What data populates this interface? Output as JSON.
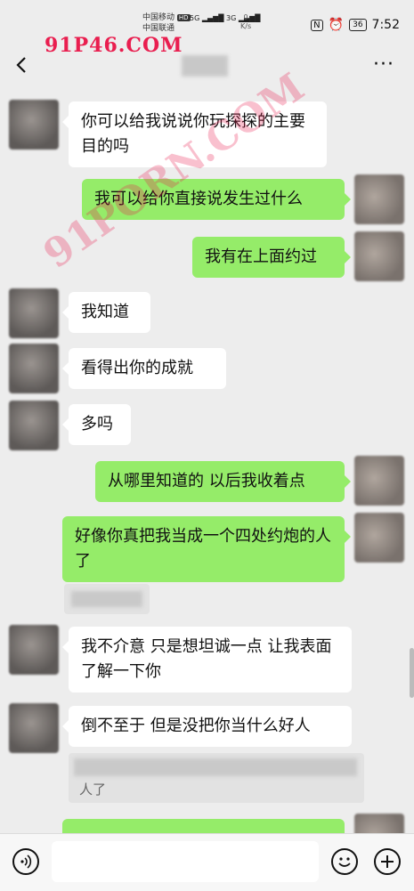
{
  "status_bar": {
    "carrier_1": "中国移动",
    "carrier_2": "中国联通",
    "hd": "HD",
    "net_1": "5G",
    "net_2": "3G",
    "speed_value": "0",
    "speed_unit": "K/s",
    "nfc": "N",
    "battery": "36",
    "time": "7:52"
  },
  "watermark": {
    "top_text": "91P46.COM",
    "diagonal_text": "91PORN.COM"
  },
  "navbar": {
    "more_label": "···"
  },
  "messages": [
    {
      "side": "in",
      "text": "你可以给我说说你玩探探的主要目的吗"
    },
    {
      "side": "out",
      "text": "我可以给你直接说发生过什么"
    },
    {
      "side": "out",
      "text": "我有在上面约过"
    },
    {
      "side": "in",
      "text": "我知道"
    },
    {
      "side": "in",
      "text": "看得出你的成就"
    },
    {
      "side": "in",
      "text": "多吗"
    },
    {
      "side": "out",
      "text": "从哪里知道的 以后我收着点"
    },
    {
      "side": "out",
      "text": "好像你真把我当成一个四处约炮的人了"
    },
    {
      "side": "in",
      "text": "我不介意 只是想坦诚一点 让我表面了解一下你"
    },
    {
      "side": "in",
      "text": "倒不至于 但是没把你当什么好人"
    },
    {
      "side": "in",
      "text": "人了"
    }
  ],
  "colors": {
    "background": "#ededed",
    "outgoing_bubble": "#95ec69",
    "incoming_bubble": "#ffffff",
    "watermark": "#e91e4f"
  },
  "icons": {
    "back": "chevron-left-icon",
    "more": "more-dots-icon",
    "voice": "voice-icon",
    "emoji": "emoji-icon",
    "plus": "plus-icon"
  }
}
